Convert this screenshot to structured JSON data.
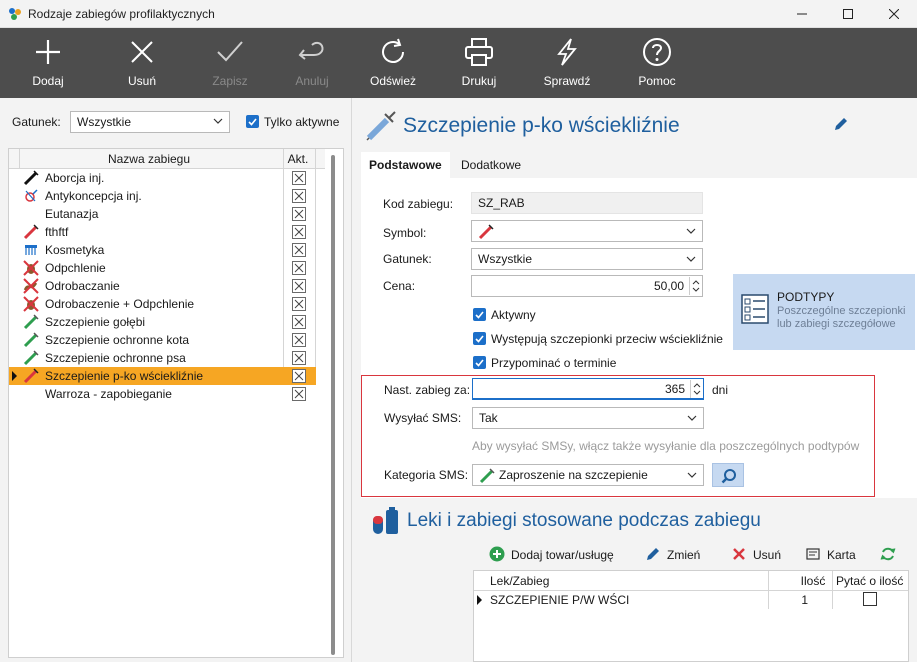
{
  "window": {
    "title": "Rodzaje zabiegów profilaktycznych"
  },
  "toolbar": {
    "buttons": [
      {
        "label": "Dodaj",
        "icon": "plus-icon",
        "enabled": true
      },
      {
        "label": "Usuń",
        "icon": "x-icon",
        "enabled": true
      },
      {
        "label": "Zapisz",
        "icon": "check-icon",
        "enabled": false
      },
      {
        "label": "Anuluj",
        "icon": "undo-icon",
        "enabled": false
      },
      {
        "label": "Odśwież",
        "icon": "refresh-icon",
        "enabled": true
      },
      {
        "label": "Drukuj",
        "icon": "printer-icon",
        "enabled": true
      },
      {
        "label": "Sprawdź",
        "icon": "lightning-icon",
        "enabled": true
      },
      {
        "label": "Pomoc",
        "icon": "help-icon",
        "enabled": true
      }
    ]
  },
  "left": {
    "gatunek_label": "Gatunek:",
    "gatunek_value": "Wszystkie",
    "tylko_aktywne_label": "Tylko aktywne",
    "tylko_aktywne_checked": true,
    "list": {
      "col_name": "Nazwa zabiegu",
      "col_akt": "Akt.",
      "items": [
        {
          "name": "Aborcja inj.",
          "icon": "syringe-black-icon"
        },
        {
          "name": "Antykoncepcja inj.",
          "icon": "gender-icon"
        },
        {
          "name": "Eutanazja",
          "icon": ""
        },
        {
          "name": "fthftf",
          "icon": "syringe-red-icon"
        },
        {
          "name": "Kosmetyka",
          "icon": "comb-icon"
        },
        {
          "name": "Odpchlenie",
          "icon": "flea-icon"
        },
        {
          "name": "Odrobaczanie",
          "icon": "worm-icon"
        },
        {
          "name": "Odrobaczenie + Odpchlenie",
          "icon": "flea-icon"
        },
        {
          "name": "Szczepienie gołębi",
          "icon": "syringe-green-icon"
        },
        {
          "name": "Szczepienie ochronne kota",
          "icon": "syringe-green-icon"
        },
        {
          "name": "Szczepienie ochronne psa",
          "icon": "syringe-green-icon"
        },
        {
          "name": "Szczepienie p-ko wściekliźnie",
          "icon": "syringe-red-icon",
          "selected": true
        },
        {
          "name": "Warroza - zapobieganie",
          "icon": ""
        }
      ]
    }
  },
  "right": {
    "title": "Szczepienie p-ko wściekliźnie",
    "tabs": [
      "Podstawowe",
      "Dodatkowe"
    ],
    "form": {
      "kod_label": "Kod zabiegu:",
      "kod_value": "SZ_RAB",
      "symbol_label": "Symbol:",
      "gatunek_label": "Gatunek:",
      "gatunek_value": "Wszystkie",
      "cena_label": "Cena:",
      "cena_value": "50,00",
      "aktywny_label": "Aktywny",
      "wystepuja_label": "Występują szczepionki przeciw wściekliźnie",
      "przypominac_label": "Przypominać o terminie",
      "nast_label": "Nast. zabieg za:",
      "nast_value": "365",
      "nast_unit": "dni",
      "sms_label": "Wysyłać SMS:",
      "sms_value": "Tak",
      "sms_hint": "Aby wysyłać SMSy, włącz także wysyłanie dla poszczególnych podtypów",
      "kategoria_label": "Kategoria SMS:",
      "kategoria_value": "Zaproszenie na szczepienie"
    },
    "podtypy": {
      "title": "PODTYPY",
      "desc": "Poszczególne szczepionki lub zabiegi szczegółowe"
    },
    "leki": {
      "title": "Leki i zabiegi stosowane podczas zabiegu",
      "buttons": {
        "dodaj": "Dodaj towar/usługę",
        "zmien": "Zmień",
        "usun": "Usuń",
        "karta": "Karta"
      },
      "columns": {
        "lek": "Lek/Zabieg",
        "ilosc": "Ilość",
        "pytac": "Pytać o ilość"
      },
      "rows": [
        {
          "lek": "SZCZEPIENIE P/W WŚCI",
          "ilosc": "1",
          "pytac": false
        }
      ]
    },
    "colors": {
      "accent": "#1f5f9e",
      "highlight": "#f6a623",
      "redbox": "#d9363e"
    }
  }
}
